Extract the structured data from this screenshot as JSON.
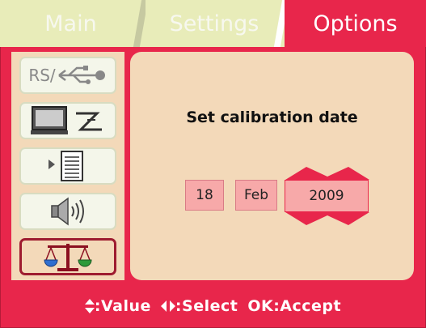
{
  "tabs": [
    {
      "label": "Main",
      "active": false
    },
    {
      "label": "Settings",
      "active": false
    },
    {
      "label": "Options",
      "active": true
    }
  ],
  "sidebar": {
    "items": [
      {
        "name": "rs-usb-interface",
        "text": "RS/",
        "icon": "rs-usb-icon",
        "selected": false
      },
      {
        "name": "display-settings",
        "icon": "monitor-z-icon",
        "selected": false
      },
      {
        "name": "menu-list",
        "icon": "list-icon",
        "selected": false
      },
      {
        "name": "sound",
        "icon": "speaker-icon",
        "selected": false
      },
      {
        "name": "calibration",
        "icon": "balance-scale-icon",
        "selected": true
      }
    ]
  },
  "panel": {
    "title": "Set calibration date",
    "day": "18",
    "month": "Feb",
    "year": "2009"
  },
  "footer": {
    "value_hint": ":Value",
    "select_hint": ":Select",
    "accept_hint": "OK:Accept"
  },
  "colors": {
    "accent": "#e8264b",
    "tab_inactive": "#e8ecb9",
    "panel": "#f3d9b9",
    "field": "#f7a9a9"
  }
}
